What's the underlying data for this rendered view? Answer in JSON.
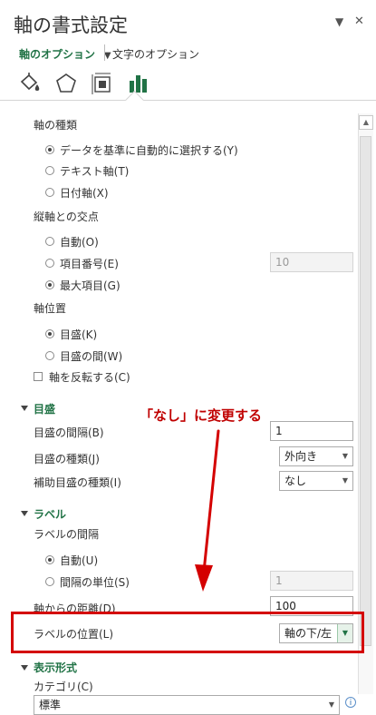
{
  "panel": {
    "title": "軸の書式設定",
    "close_glyph": "✕",
    "pin_glyph": "▼",
    "tabs": {
      "axis_options": "軸のオプション",
      "text_options": "文字のオプション"
    }
  },
  "axis_type": {
    "heading": "軸の種類",
    "options": [
      "データを基準に自動的に選択する(Y)",
      "テキスト軸(T)",
      "日付軸(X)"
    ],
    "selected": 0
  },
  "crosses": {
    "heading": "縦軸との交点",
    "options": [
      "自動(O)",
      "項目番号(E)",
      "最大項目(G)"
    ],
    "selected": 2,
    "category_number_value": "10"
  },
  "axis_position": {
    "heading": "軸位置",
    "options": [
      "目盛(K)",
      "目盛の間(W)"
    ],
    "selected": 0,
    "reverse_label": "軸を反転する(C)"
  },
  "tick_marks": {
    "heading": "目盛",
    "interval_label": "目盛の間隔(B)",
    "interval_value": "1",
    "major_type_label": "目盛の種類(J)",
    "major_type_value": "外向き",
    "minor_type_label": "補助目盛の種類(I)",
    "minor_type_value": "なし"
  },
  "labels": {
    "heading": "ラベル",
    "interval_heading": "ラベルの間隔",
    "interval_options": [
      "自動(U)",
      "間隔の単位(S)"
    ],
    "interval_selected": 0,
    "interval_unit_value": "1",
    "distance_label": "軸からの距離(D)",
    "distance_value": "100",
    "position_label": "ラベルの位置(L)",
    "position_value": "軸の下/左"
  },
  "number": {
    "heading": "表示形式",
    "category_label": "カテゴリ(C)",
    "category_value": "標準"
  },
  "annotation": {
    "text": "「なし」に変更する",
    "color": "#c00000"
  },
  "colors": {
    "accent": "#217346",
    "highlight": "#d40000"
  }
}
